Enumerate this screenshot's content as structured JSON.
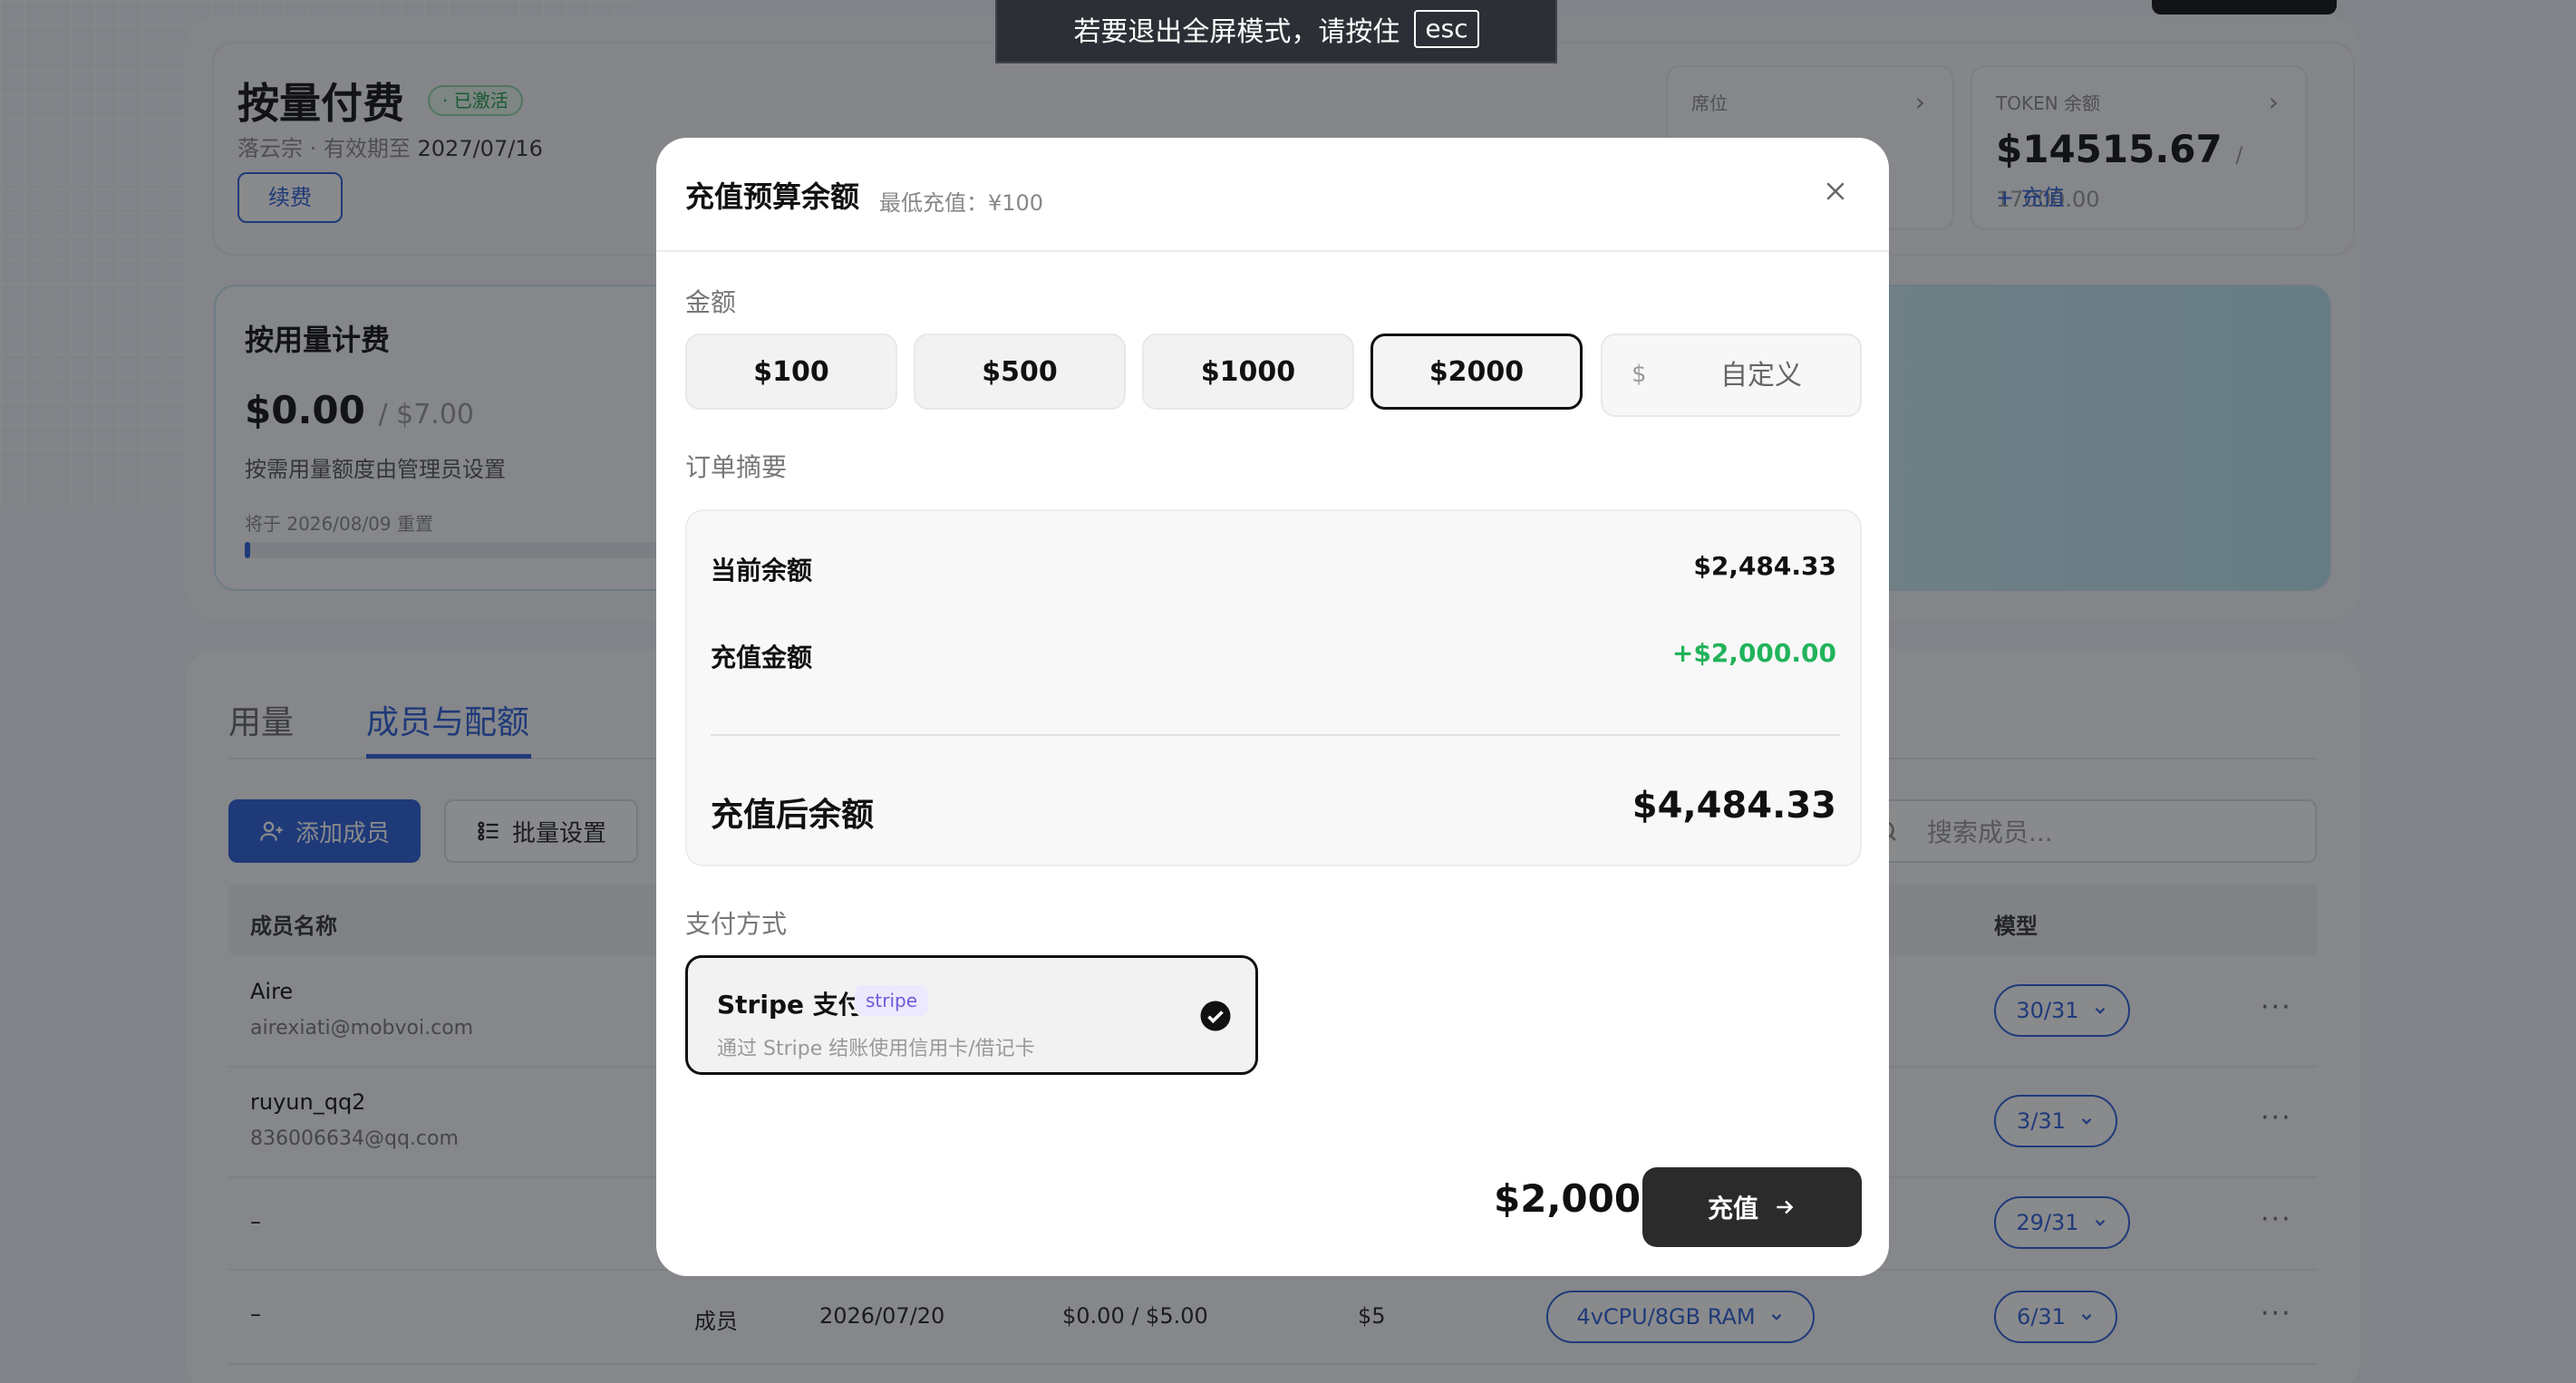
{
  "fullscreen_toast": {
    "text": "若要退出全屏模式，请按住",
    "key": "esc"
  },
  "plan": {
    "title": "按量付费",
    "status_badge": "· 已激活",
    "owner": "落云宗",
    "expiry_prefix": " · 有效期至 ",
    "expiry_date": "2027/07/16",
    "renew_label": "续费"
  },
  "seats_card": {
    "label": "席位"
  },
  "token_card": {
    "label": "TOKEN 余额",
    "value": "$14515.67",
    "total": "/ 17000.00",
    "topup_link": "+ 充值"
  },
  "usage_card": {
    "title": "按用量计费",
    "amount": "$0.00",
    "limit": "/ $7.00",
    "note": "按需用量额度由管理员设置",
    "reset_note": "将于 2026/08/09 重置",
    "progress_fraction": 0.01
  },
  "tabs": {
    "usage": "用量",
    "members": "成员与配额"
  },
  "toolbar": {
    "add_member": "添加成员",
    "batch_settings": "批量设置",
    "search_placeholder": "搜索成员..."
  },
  "table": {
    "col_name": "成员名称",
    "col_model": "模型",
    "rows": [
      {
        "name": "Aire",
        "email": "airexiati@mobvoi.com",
        "model": "30/31"
      },
      {
        "name": "ruyun_qq2",
        "email": "836006634@qq.com",
        "model": "3/31"
      },
      {
        "name": "–",
        "email": "",
        "model": "29/31"
      },
      {
        "name": "–",
        "email": "",
        "role": "成员",
        "date": "2026/07/20",
        "usage": "$0.00 / $5.00",
        "limit": "$5",
        "spec": "4vCPU/8GB RAM",
        "model": "6/31"
      }
    ]
  },
  "modal": {
    "title": "充值预算余额",
    "min_note": "最低充值：¥100",
    "amount_label": "金额",
    "amounts": [
      "$100",
      "$500",
      "$1000",
      "$2000"
    ],
    "selected_amount": "$2000",
    "custom_currency": "$",
    "custom_placeholder": "自定义",
    "summary_label": "订单摘要",
    "current_balance_label": "当前余额",
    "current_balance": "$2,484.33",
    "topup_label": "充值金额",
    "topup_value": "+$2,000.00",
    "after_label": "充值后余额",
    "after_value": "$4,484.33",
    "payment_label": "支付方式",
    "payment_name": "Stripe 支付",
    "payment_badge": "stripe",
    "payment_desc": "通过 Stripe 结账使用信用卡/借记卡",
    "footer_total": "$2,000",
    "submit_label": "充值"
  },
  "colors": {
    "accent": "#2b5ed8",
    "success": "#22b35a",
    "primary_button": "#2b2b2b",
    "overlay": "rgba(20,22,26,0.5)"
  }
}
